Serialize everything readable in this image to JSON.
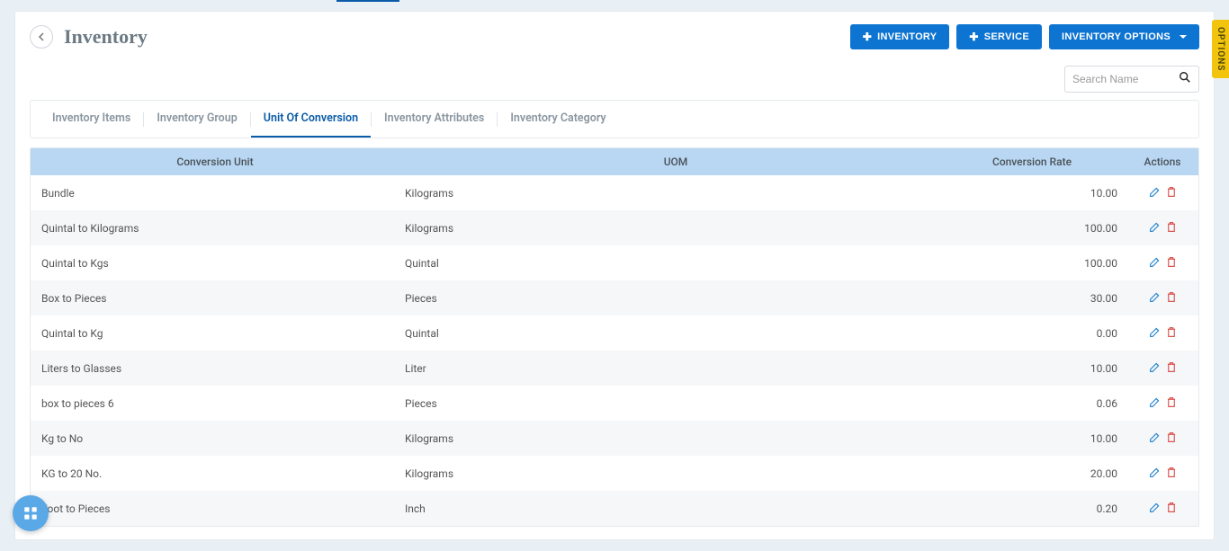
{
  "header": {
    "title": "Inventory",
    "buttons": {
      "inventory": "INVENTORY",
      "service": "SERVICE",
      "options": "INVENTORY OPTIONS"
    }
  },
  "search": {
    "placeholder": "Search Name"
  },
  "tabs": [
    {
      "label": "Inventory Items",
      "active": false
    },
    {
      "label": "Inventory Group",
      "active": false
    },
    {
      "label": "Unit Of Conversion",
      "active": true
    },
    {
      "label": "Inventory Attributes",
      "active": false
    },
    {
      "label": "Inventory Category",
      "active": false
    }
  ],
  "columns": {
    "unit": "Conversion Unit",
    "uom": "UOM",
    "rate": "Conversion Rate",
    "actions": "Actions"
  },
  "rows": [
    {
      "unit": "Bundle",
      "uom": "Kilograms",
      "rate": "10.00"
    },
    {
      "unit": "Quintal to Kilograms",
      "uom": "Kilograms",
      "rate": "100.00"
    },
    {
      "unit": "Quintal to Kgs",
      "uom": "Quintal",
      "rate": "100.00"
    },
    {
      "unit": "Box to Pieces",
      "uom": "Pieces",
      "rate": "30.00"
    },
    {
      "unit": "Quintal to Kg",
      "uom": "Quintal",
      "rate": "0.00"
    },
    {
      "unit": "Liters to Glasses",
      "uom": "Liter",
      "rate": "10.00"
    },
    {
      "unit": "box to pieces 6",
      "uom": "Pieces",
      "rate": "0.06"
    },
    {
      "unit": "Kg to No",
      "uom": "Kilograms",
      "rate": "10.00"
    },
    {
      "unit": "KG to 20 No.",
      "uom": "Kilograms",
      "rate": "20.00"
    },
    {
      "unit": "Foot to Pieces",
      "uom": "Inch",
      "rate": "0.20"
    }
  ],
  "side_tab": "OPTIONS"
}
